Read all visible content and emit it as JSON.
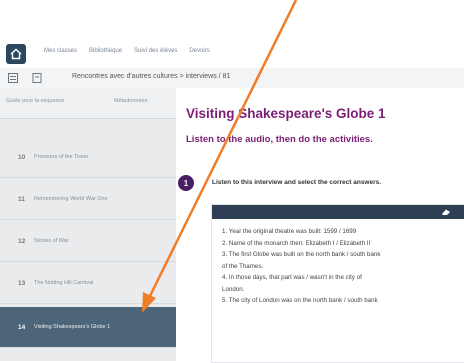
{
  "topnav": {
    "links": [
      "Mes classes",
      "Bibliothèque",
      "Suivi des élèves",
      "Devoirs"
    ]
  },
  "breadcrumb": {
    "text": "Rencontres avec d'autres cultures > interviews / 81"
  },
  "sidebar": {
    "tabs": [
      "Guide pour la séquence",
      "Métadonnées"
    ],
    "items": [
      {
        "num": "10",
        "label": "Prisoners of the Tower"
      },
      {
        "num": "11",
        "label": "Remembering World War One"
      },
      {
        "num": "12",
        "label": "Stories of War"
      },
      {
        "num": "13",
        "label": "The Notting Hill Carnival"
      },
      {
        "num": "14",
        "label": "Visiting Shakespeare's Globe 1"
      }
    ]
  },
  "main": {
    "title": "Visiting Shakespeare's Globe 1",
    "subtitle": "Listen to the audio, then do the activities.",
    "step_number": "1",
    "instruction": "Listen to this interview and select the correct answers.",
    "questions": [
      "1. Year the original theatre was built: 1599 / 1699",
      "2. Name of the monarch then: Elizabeth I / Elizabeth II",
      "3. The first Globe was built on the north bank / south bank",
      "of the Thames.",
      "4. In those days, that part was / wasn't in the city of",
      "London.",
      "5. The city of London was on the north bank / south bank"
    ]
  },
  "colors": {
    "title": "#7b1f74",
    "sidebar_active": "#4d6578",
    "activity_bar": "#2e3f55",
    "arrow": "#f07d2a"
  },
  "icons": {
    "home": "home-icon",
    "list": "list-icon",
    "document": "document-icon",
    "eraser": "eraser-icon"
  }
}
